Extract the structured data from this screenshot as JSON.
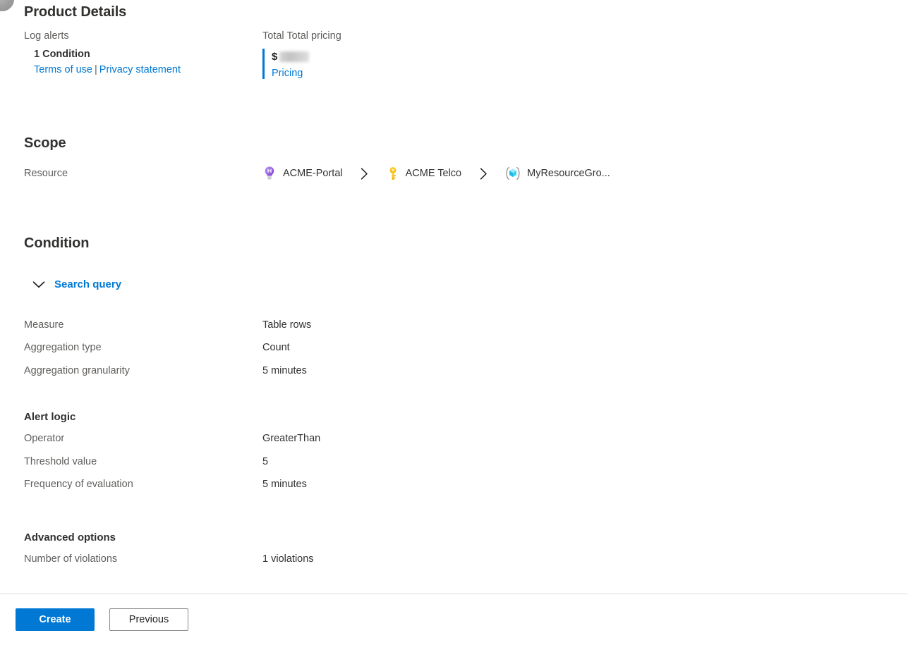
{
  "product_details": {
    "title": "Product Details",
    "left": {
      "label": "Log alerts",
      "condition": "1 Condition",
      "terms_link": "Terms of use",
      "separator": "|",
      "privacy_link": "Privacy statement"
    },
    "right": {
      "label": "Total Total pricing",
      "currency": "$",
      "amount": "",
      "pricing_link": "Pricing"
    }
  },
  "scope": {
    "title": "Scope",
    "resource_label": "Resource",
    "breadcrumb": [
      {
        "icon": "lightbulb-icon",
        "label": "ACME-Portal"
      },
      {
        "icon": "key-icon",
        "label": "ACME Telco"
      },
      {
        "icon": "resource-group-icon",
        "label": "MyResourceGro..."
      }
    ]
  },
  "condition": {
    "title": "Condition",
    "search_query_label": "Search query",
    "search_query_expanded": true,
    "measure_rows": [
      {
        "key": "Measure",
        "value": "Table rows"
      },
      {
        "key": "Aggregation type",
        "value": "Count"
      },
      {
        "key": "Aggregation granularity",
        "value": "5 minutes"
      }
    ],
    "alert_logic": {
      "heading": "Alert logic",
      "rows": [
        {
          "key": "Operator",
          "value": "GreaterThan"
        },
        {
          "key": "Threshold value",
          "value": "5"
        },
        {
          "key": "Frequency of evaluation",
          "value": "5 minutes"
        }
      ]
    },
    "advanced_options": {
      "heading": "Advanced options",
      "rows": [
        {
          "key": "Number of violations",
          "value": "1 violations"
        }
      ]
    }
  },
  "footer": {
    "create_label": "Create",
    "previous_label": "Previous"
  },
  "colors": {
    "accent": "#0078d4",
    "text_primary": "#323130",
    "text_secondary": "#605e5c",
    "divider": "#e1dfdd"
  }
}
